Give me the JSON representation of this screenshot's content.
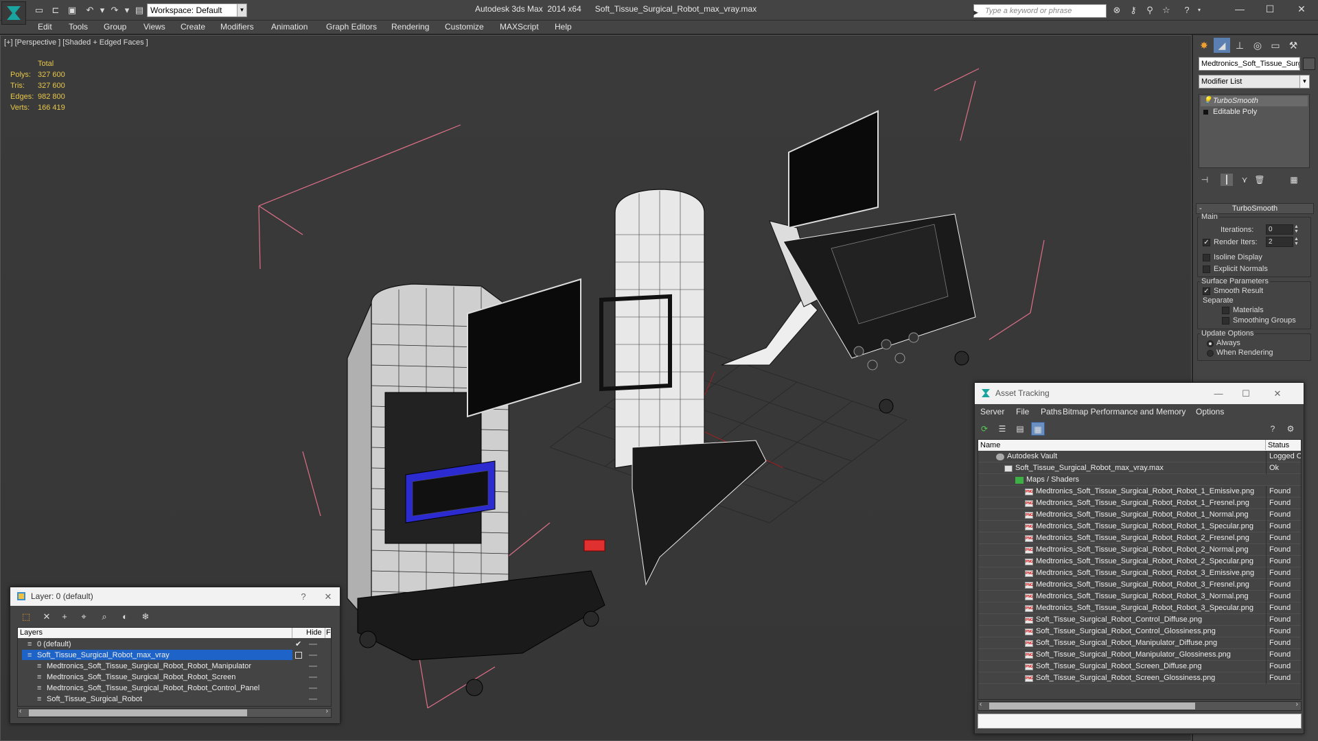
{
  "titlebar": {
    "workspace": "Workspace: Default",
    "title": "Autodesk 3ds Max  2014 x64      Soft_Tissue_Surgical_Robot_max_vray.max",
    "search_placeholder": "Type a keyword or phrase"
  },
  "menu": [
    "Edit",
    "Tools",
    "Group",
    "Views",
    "Create",
    "Modifiers",
    "Animation",
    "Graph Editors",
    "Rendering",
    "Customize",
    "MAXScript",
    "Help"
  ],
  "viewport": {
    "label": "[+] [Perspective ] [Shaded + Edged Faces ]",
    "stats": {
      "header": "Total",
      "rows": [
        {
          "label": "Polys:",
          "value": "327 600"
        },
        {
          "label": "Tris:",
          "value": "327 600"
        },
        {
          "label": "Edges:",
          "value": "982 800"
        },
        {
          "label": "Verts:",
          "value": "166 419"
        }
      ]
    },
    "colors": {
      "bbox": "#e0708a",
      "wire": "#111111",
      "grid": "#2a2a2a",
      "stats": "#e8c84a"
    }
  },
  "command_panel": {
    "object_name": "Medtronics_Soft_Tissue_Surg",
    "modifier_list": "Modifier List",
    "stack": [
      "TurboSmooth",
      "Editable Poly"
    ],
    "rollout_title": "TurboSmooth",
    "main_group": "Main",
    "iterations_label": "Iterations:",
    "iterations_value": "0",
    "render_iters_label": "Render Iters:",
    "render_iters_value": "2",
    "render_iters_checked": true,
    "isoline_label": "Isoline Display",
    "explicit_normals_label": "Explicit Normals",
    "surface_group": "Surface Parameters",
    "smooth_result_label": "Smooth Result",
    "separate_label": "Separate",
    "materials_label": "Materials",
    "smoothing_groups_label": "Smoothing Groups",
    "update_group": "Update Options",
    "always_label": "Always",
    "when_rendering_label": "When Rendering"
  },
  "layer_dialog": {
    "title": "Layer: 0 (default)",
    "help": "?",
    "close": "✕",
    "columns": {
      "layers": "Layers",
      "hide": "Hide",
      "f": "F"
    },
    "rows": [
      {
        "name": "0 (default)",
        "indent": 1,
        "checked": true,
        "selected": false
      },
      {
        "name": "Soft_Tissue_Surgical_Robot_max_vray",
        "indent": 1,
        "checked": false,
        "selected": true
      },
      {
        "name": "Medtronics_Soft_Tissue_Surgical_Robot_Robot_Manipulator",
        "indent": 2,
        "checked": false,
        "selected": false
      },
      {
        "name": "Medtronics_Soft_Tissue_Surgical_Robot_Robot_Screen",
        "indent": 2,
        "checked": false,
        "selected": false
      },
      {
        "name": "Medtronics_Soft_Tissue_Surgical_Robot_Robot_Control_Panel",
        "indent": 2,
        "checked": false,
        "selected": false
      },
      {
        "name": "Soft_Tissue_Surgical_Robot",
        "indent": 2,
        "checked": false,
        "selected": false
      }
    ]
  },
  "asset_dialog": {
    "title": "Asset Tracking",
    "menu": [
      "Server",
      "File",
      "Paths",
      "Bitmap Performance and Memory",
      "Options"
    ],
    "columns": {
      "name": "Name",
      "status": "Status"
    },
    "rows": [
      {
        "name": "Autodesk Vault",
        "status": "Logged Out",
        "level": 0,
        "icon": "vault"
      },
      {
        "name": "Soft_Tissue_Surgical_Robot_max_vray.max",
        "status": "Ok",
        "level": 1,
        "icon": "max"
      },
      {
        "name": "Maps / Shaders",
        "status": "",
        "level": 2,
        "icon": "maps"
      },
      {
        "name": "Medtronics_Soft_Tissue_Surgical_Robot_Robot_1_Emissive.png",
        "status": "Found",
        "level": 3,
        "icon": "png"
      },
      {
        "name": "Medtronics_Soft_Tissue_Surgical_Robot_Robot_1_Fresnel.png",
        "status": "Found",
        "level": 3,
        "icon": "png"
      },
      {
        "name": "Medtronics_Soft_Tissue_Surgical_Robot_Robot_1_Normal.png",
        "status": "Found",
        "level": 3,
        "icon": "png"
      },
      {
        "name": "Medtronics_Soft_Tissue_Surgical_Robot_Robot_1_Specular.png",
        "status": "Found",
        "level": 3,
        "icon": "png"
      },
      {
        "name": "Medtronics_Soft_Tissue_Surgical_Robot_Robot_2_Fresnel.png",
        "status": "Found",
        "level": 3,
        "icon": "png"
      },
      {
        "name": "Medtronics_Soft_Tissue_Surgical_Robot_Robot_2_Normal.png",
        "status": "Found",
        "level": 3,
        "icon": "png"
      },
      {
        "name": "Medtronics_Soft_Tissue_Surgical_Robot_Robot_2_Specular.png",
        "status": "Found",
        "level": 3,
        "icon": "png"
      },
      {
        "name": "Medtronics_Soft_Tissue_Surgical_Robot_Robot_3_Emissive.png",
        "status": "Found",
        "level": 3,
        "icon": "png"
      },
      {
        "name": "Medtronics_Soft_Tissue_Surgical_Robot_Robot_3_Fresnel.png",
        "status": "Found",
        "level": 3,
        "icon": "png"
      },
      {
        "name": "Medtronics_Soft_Tissue_Surgical_Robot_Robot_3_Normal.png",
        "status": "Found",
        "level": 3,
        "icon": "png"
      },
      {
        "name": "Medtronics_Soft_Tissue_Surgical_Robot_Robot_3_Specular.png",
        "status": "Found",
        "level": 3,
        "icon": "png"
      },
      {
        "name": "Soft_Tissue_Surgical_Robot_Control_Diffuse.png",
        "status": "Found",
        "level": 3,
        "icon": "png"
      },
      {
        "name": "Soft_Tissue_Surgical_Robot_Control_Glossiness.png",
        "status": "Found",
        "level": 3,
        "icon": "png"
      },
      {
        "name": "Soft_Tissue_Surgical_Robot_Manipulator_Diffuse.png",
        "status": "Found",
        "level": 3,
        "icon": "png"
      },
      {
        "name": "Soft_Tissue_Surgical_Robot_Manipulator_Glossiness.png",
        "status": "Found",
        "level": 3,
        "icon": "png"
      },
      {
        "name": "Soft_Tissue_Surgical_Robot_Screen_Diffuse.png",
        "status": "Found",
        "level": 3,
        "icon": "png"
      },
      {
        "name": "Soft_Tissue_Surgical_Robot_Screen_Glossiness.png",
        "status": "Found",
        "level": 3,
        "icon": "png"
      }
    ]
  }
}
